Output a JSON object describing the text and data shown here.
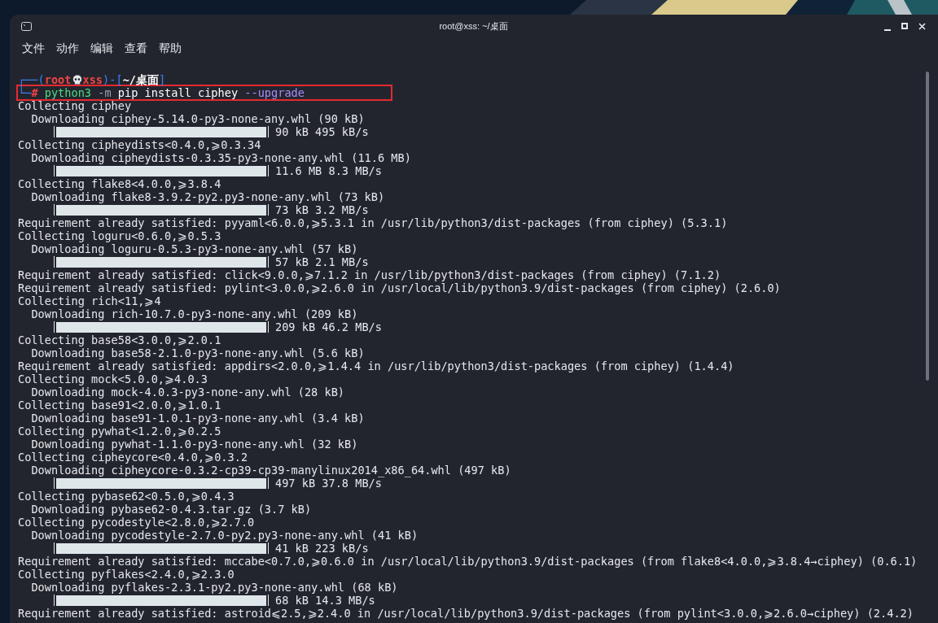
{
  "window": {
    "title": "root@xss: ~/桌面"
  },
  "menu": [
    "文件",
    "动作",
    "编辑",
    "查看",
    "帮助"
  ],
  "prompt": {
    "frame_open": "┌──(",
    "user": "root",
    "host": "xss",
    "frame_mid": ")-[",
    "path": "~/桌面",
    "frame_close": "]",
    "frame_bottom": "└─",
    "symbol": "#",
    "command": [
      {
        "kind": "program",
        "text": "python3"
      },
      {
        "kind": "flag",
        "text": "-m"
      },
      {
        "kind": "args",
        "text": "pip install ciphey"
      },
      {
        "kind": "option",
        "text": "--upgrade"
      }
    ],
    "highlighted": true
  },
  "output": [
    {
      "kind": "line",
      "text": "Collecting ciphey"
    },
    {
      "kind": "indented",
      "text": "Downloading ciphey-5.14.0-py3-none-any.whl (90 kB)"
    },
    {
      "kind": "progress",
      "level": 1,
      "reading": "90 kB 495 kB/s"
    },
    {
      "kind": "line",
      "text": "Collecting cipheydists<0.4.0,⩾0.3.34"
    },
    {
      "kind": "indented",
      "text": "Downloading cipheydists-0.3.35-py3-none-any.whl (11.6 MB)"
    },
    {
      "kind": "progress",
      "level": 1,
      "reading": "11.6 MB 8.3 MB/s"
    },
    {
      "kind": "line",
      "text": "Collecting flake8<4.0.0,⩾3.8.4"
    },
    {
      "kind": "indented",
      "text": "Downloading flake8-3.9.2-py2.py3-none-any.whl (73 kB)"
    },
    {
      "kind": "progress",
      "level": 1,
      "reading": "73 kB 3.2 MB/s"
    },
    {
      "kind": "line",
      "text": "Requirement already satisfied: pyyaml<6.0.0,⩾5.3.1 in /usr/lib/python3/dist-packages (from ciphey) (5.3.1)"
    },
    {
      "kind": "line",
      "text": "Collecting loguru<0.6.0,⩾0.5.3"
    },
    {
      "kind": "indented",
      "text": "Downloading loguru-0.5.3-py3-none-any.whl (57 kB)"
    },
    {
      "kind": "progress",
      "level": 1,
      "reading": "57 kB 2.1 MB/s"
    },
    {
      "kind": "line",
      "text": "Requirement already satisfied: click<9.0.0,⩾7.1.2 in /usr/lib/python3/dist-packages (from ciphey) (7.1.2)"
    },
    {
      "kind": "line",
      "text": "Requirement already satisfied: pylint<3.0.0,⩾2.6.0 in /usr/local/lib/python3.9/dist-packages (from ciphey) (2.6.0)"
    },
    {
      "kind": "line",
      "text": "Collecting rich<11,⩾4"
    },
    {
      "kind": "indented",
      "text": "Downloading rich-10.7.0-py3-none-any.whl (209 kB)"
    },
    {
      "kind": "progress",
      "level": 1,
      "reading": "209 kB 46.2 MB/s"
    },
    {
      "kind": "line",
      "text": "Collecting base58<3.0.0,⩾2.0.1"
    },
    {
      "kind": "indented",
      "text": "Downloading base58-2.1.0-py3-none-any.whl (5.6 kB)"
    },
    {
      "kind": "line",
      "text": "Requirement already satisfied: appdirs<2.0.0,⩾1.4.4 in /usr/lib/python3/dist-packages (from ciphey) (1.4.4)"
    },
    {
      "kind": "line",
      "text": "Collecting mock<5.0.0,⩾4.0.3"
    },
    {
      "kind": "indented",
      "text": "Downloading mock-4.0.3-py3-none-any.whl (28 kB)"
    },
    {
      "kind": "line",
      "text": "Collecting base91<2.0.0,⩾1.0.1"
    },
    {
      "kind": "indented",
      "text": "Downloading base91-1.0.1-py3-none-any.whl (3.4 kB)"
    },
    {
      "kind": "line",
      "text": "Collecting pywhat<1.2.0,⩾0.2.5"
    },
    {
      "kind": "indented",
      "text": "Downloading pywhat-1.1.0-py3-none-any.whl (32 kB)"
    },
    {
      "kind": "line",
      "text": "Collecting cipheycore<0.4.0,⩾0.3.2"
    },
    {
      "kind": "indented",
      "text": "Downloading cipheycore-0.3.2-cp39-cp39-manylinux2014_x86_64.whl (497 kB)"
    },
    {
      "kind": "progress",
      "level": 1,
      "reading": "497 kB 37.8 MB/s"
    },
    {
      "kind": "line",
      "text": "Collecting pybase62<0.5.0,⩾0.4.3"
    },
    {
      "kind": "indented",
      "text": "Downloading pybase62-0.4.3.tar.gz (3.7 kB)"
    },
    {
      "kind": "line",
      "text": "Collecting pycodestyle<2.8.0,⩾2.7.0"
    },
    {
      "kind": "indented",
      "text": "Downloading pycodestyle-2.7.0-py2.py3-none-any.whl (41 kB)"
    },
    {
      "kind": "progress",
      "level": 1,
      "reading": "41 kB 223 kB/s"
    },
    {
      "kind": "line",
      "text": "Requirement already satisfied: mccabe<0.7.0,⩾0.6.0 in /usr/local/lib/python3.9/dist-packages (from flake8<4.0.0,⩾3.8.4→ciphey) (0.6.1)"
    },
    {
      "kind": "line",
      "text": "Collecting pyflakes<2.4.0,⩾2.3.0"
    },
    {
      "kind": "indented",
      "text": "Downloading pyflakes-2.3.1-py2.py3-none-any.whl (68 kB)"
    },
    {
      "kind": "progress",
      "level": 1,
      "reading": "68 kB 14.3 MB/s"
    },
    {
      "kind": "line",
      "text": "Requirement already satisfied: astroid⩽2.5,⩾2.4.0 in /usr/local/lib/python3.9/dist-packages (from pylint<3.0.0,⩾2.6.0→ciphey) (2.4.2)"
    }
  ]
}
